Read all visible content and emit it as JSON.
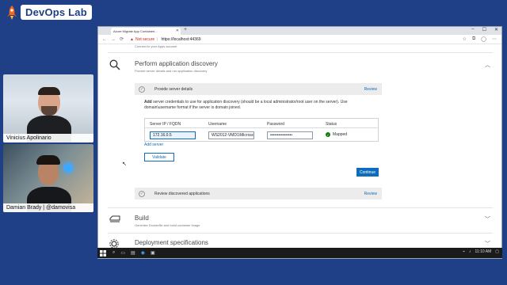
{
  "brand": {
    "name": "DevOps Lab",
    "icon": "rocket-icon"
  },
  "webcams": [
    {
      "name": "Vinicius Apolinario"
    },
    {
      "name": "Damian Brady | @damovisa"
    }
  ],
  "browser": {
    "tab_title": "Azure Migrate App Containeri...",
    "address": {
      "security_text": "Not secure",
      "url": "https://localhost:44369"
    }
  },
  "page": {
    "top_subtitle": "Connect to your Apps account",
    "discovery": {
      "title": "Perform application discovery",
      "subtitle": "Provide server details and run application discovery"
    },
    "steps": {
      "provide": {
        "label": "Provide server details",
        "review": "Review"
      },
      "review_discovered": {
        "label": "Review discovered applications",
        "review": "Review"
      }
    },
    "description": {
      "bold": "Add",
      "rest": " server credentials to use for application discovery (should be a local administrator/root user on the server). Use domain\\username format if the server is domain joined."
    },
    "table": {
      "headers": [
        "Server IP / FQDN",
        "Username",
        "Password",
        "Status"
      ],
      "row": {
        "ip": "172.16.0.5",
        "username": "WS2012-VMD1\\Microsof",
        "password": "••••••••••••••••",
        "status": "Mapped"
      }
    },
    "add_server": "Add server",
    "validate_button": "Validate",
    "continue_button": "Continue",
    "build": {
      "title": "Build",
      "subtitle": "Generate Dockerfile and build container image"
    },
    "deployment": {
      "title": "Deployment specifications"
    }
  },
  "taskbar": {
    "search_placeholder": "Search",
    "time": "11:10 AM"
  },
  "colors": {
    "accent": "#0f6cbd",
    "success": "#107c10",
    "brand_bg": "#1f3f86"
  }
}
